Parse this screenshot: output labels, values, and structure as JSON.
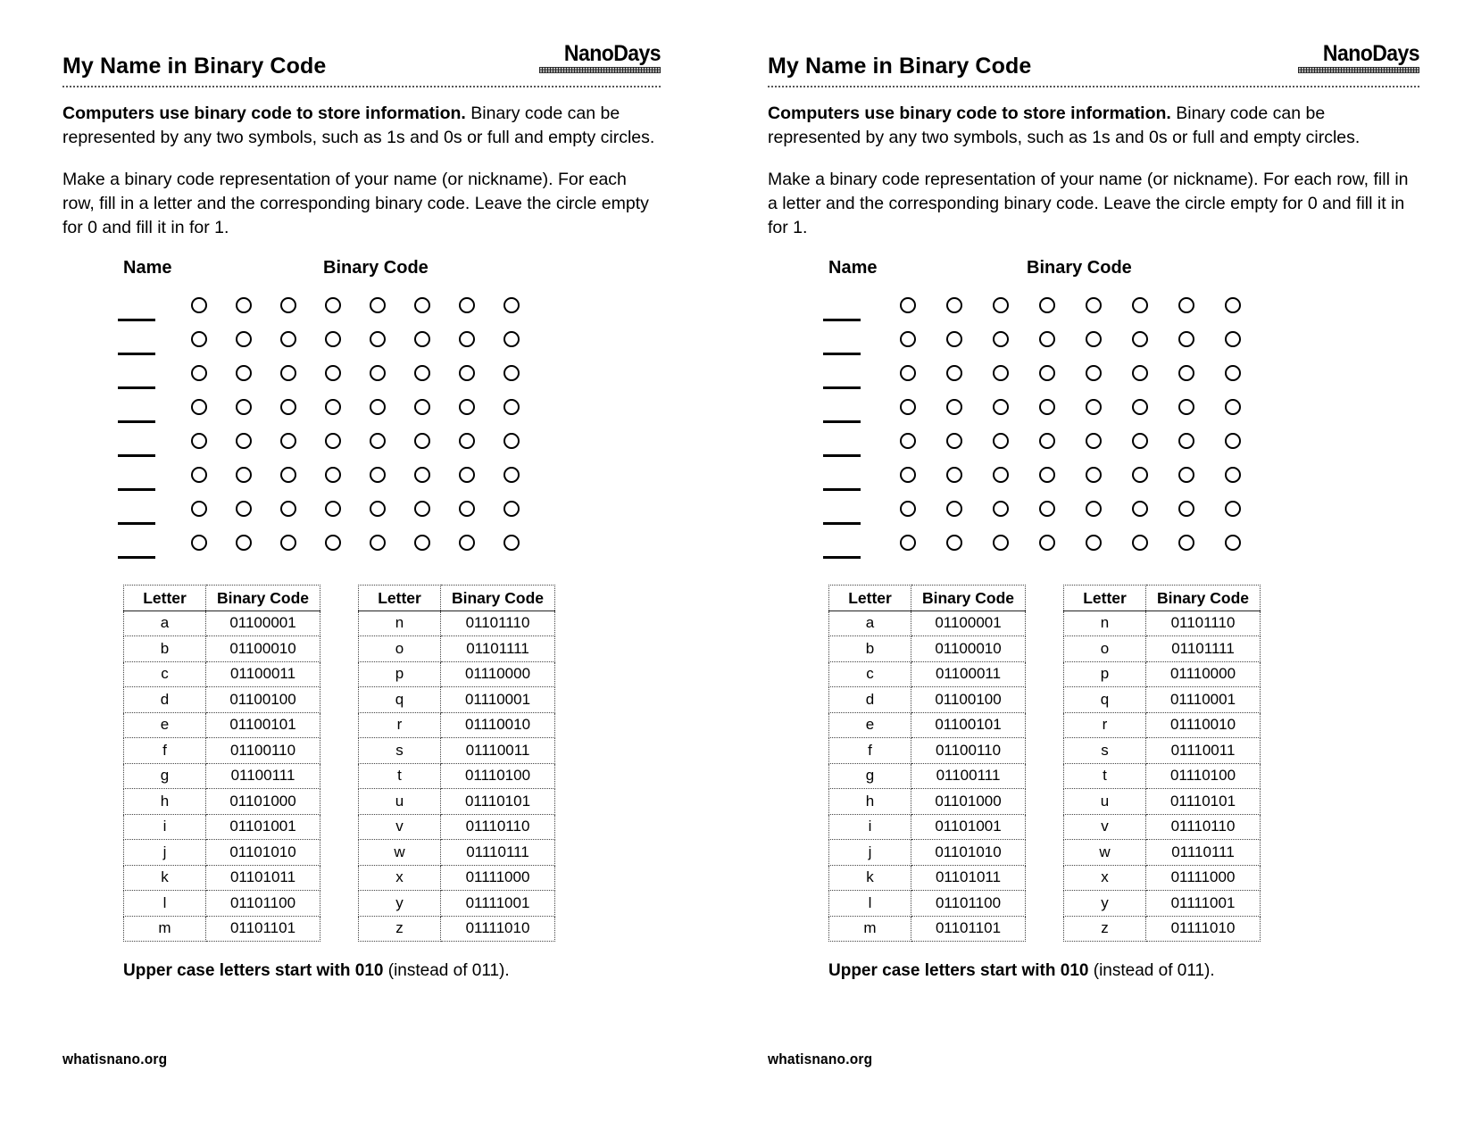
{
  "logo": {
    "word": "NanoDays",
    "bar": "textured-rule"
  },
  "title": "My Name in Binary Code",
  "intro": {
    "lead": "Computers use binary code to store information.",
    "rest": " Binary code can be represented by any two symbols, such as 1s and 0s or full and empty circles."
  },
  "instructions_left": "Make a binary code representation of your name (or nickname). For each row, fill in a letter and the corresponding binary code. Leave the circle empty for 0 and fill it in for 1.",
  "instructions_right": "Make a binary code representation of your name (or nickname). For each row, fill in a letter and the corresponding binary code. Leave the circle empty for 0 and fill it in for 1.",
  "grid": {
    "name_heading": "Name",
    "binary_heading": "Binary Code",
    "rows": 8,
    "columns": 8,
    "circle_state": "empty"
  },
  "tables": {
    "headers": {
      "letter": "Letter",
      "code": "Binary Code"
    },
    "first": [
      {
        "letter": "a",
        "code": "01100001"
      },
      {
        "letter": "b",
        "code": "01100010"
      },
      {
        "letter": "c",
        "code": "01100011"
      },
      {
        "letter": "d",
        "code": "01100100"
      },
      {
        "letter": "e",
        "code": "01100101"
      },
      {
        "letter": "f",
        "code": "01100110"
      },
      {
        "letter": "g",
        "code": "01100111"
      },
      {
        "letter": "h",
        "code": "01101000"
      },
      {
        "letter": "i",
        "code": "01101001"
      },
      {
        "letter": "j",
        "code": "01101010"
      },
      {
        "letter": "k",
        "code": "01101011"
      },
      {
        "letter": "l",
        "code": "01101100"
      },
      {
        "letter": "m",
        "code": "01101101"
      }
    ],
    "second": [
      {
        "letter": "n",
        "code": "01101110"
      },
      {
        "letter": "o",
        "code": "01101111"
      },
      {
        "letter": "p",
        "code": "01110000"
      },
      {
        "letter": "q",
        "code": "01110001"
      },
      {
        "letter": "r",
        "code": "01110010"
      },
      {
        "letter": "s",
        "code": "01110011"
      },
      {
        "letter": "t",
        "code": "01110100"
      },
      {
        "letter": "u",
        "code": "01110101"
      },
      {
        "letter": "v",
        "code": "01110110"
      },
      {
        "letter": "w",
        "code": "01110111"
      },
      {
        "letter": "x",
        "code": "01111000"
      },
      {
        "letter": "y",
        "code": "01111001"
      },
      {
        "letter": "z",
        "code": "01111010"
      }
    ]
  },
  "note": {
    "bold": "Upper case letters start with 010",
    "rest": " (instead of 011)."
  },
  "footer": "whatisnano.org"
}
